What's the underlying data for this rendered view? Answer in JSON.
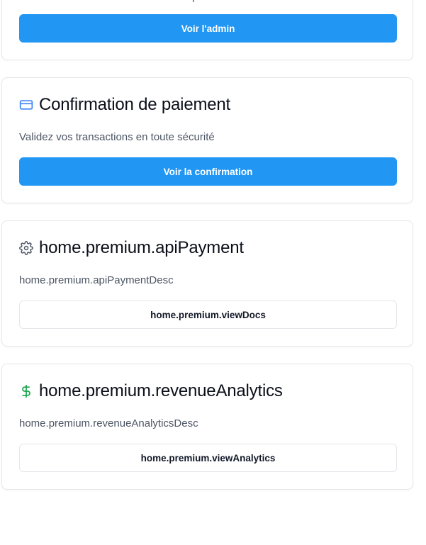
{
  "cards": [
    {
      "id": "admin",
      "description_partial": "p",
      "button_label": "Voir l'admin"
    },
    {
      "id": "payment-confirmation",
      "icon": "credit-card-icon",
      "icon_color": "#3b82f6",
      "title": "Confirmation de paiement",
      "description": "Validez vos transactions en toute sécurité",
      "button_label": "Voir la confirmation"
    },
    {
      "id": "api-payment",
      "icon": "gear-icon",
      "icon_color": "#4b5563",
      "title": "home.premium.apiPayment",
      "description": "home.premium.apiPaymentDesc",
      "button_label": "home.premium.viewDocs"
    },
    {
      "id": "revenue-analytics",
      "icon": "dollar-icon",
      "icon_color": "#16a34a",
      "title": "home.premium.revenueAnalytics",
      "description": "home.premium.revenueAnalyticsDesc",
      "button_label": "home.premium.viewAnalytics"
    }
  ],
  "colors": {
    "primary_button": "#2196f3",
    "card_border": "#e5e7eb",
    "text_muted": "#4b5563"
  }
}
